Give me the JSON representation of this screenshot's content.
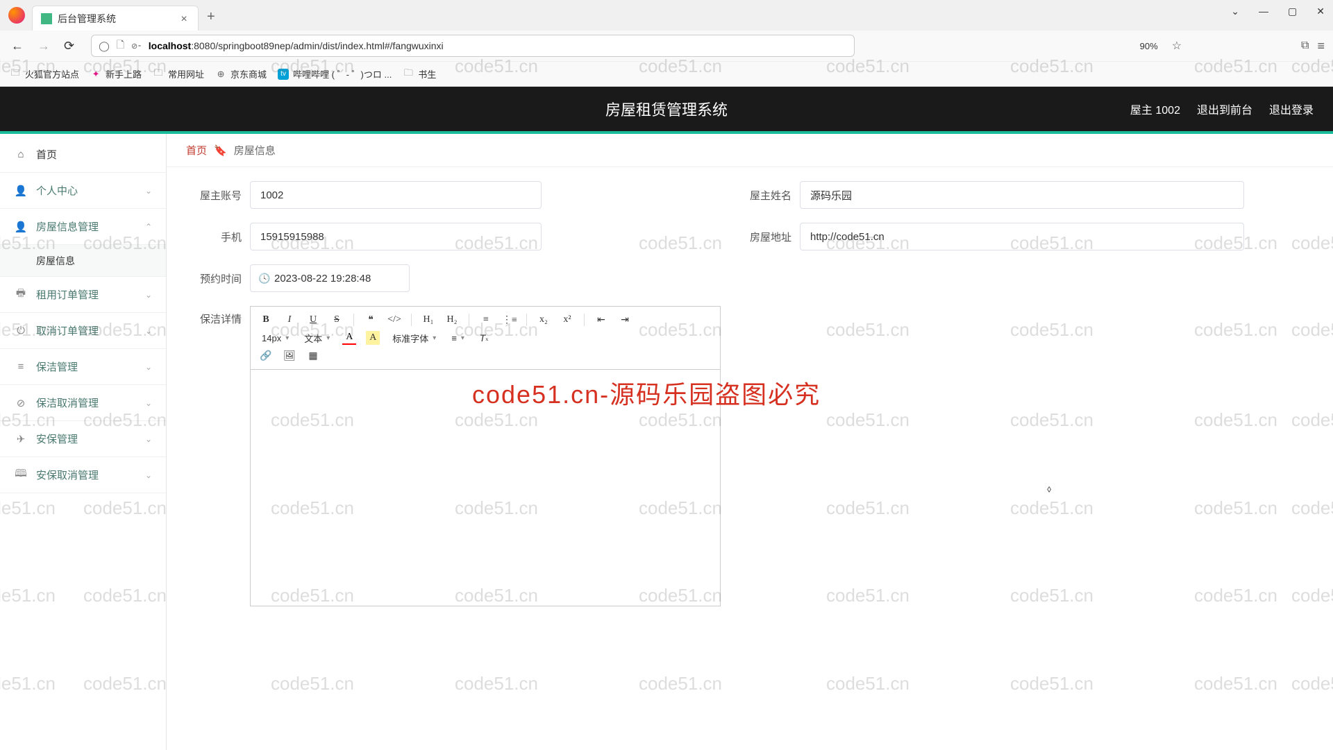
{
  "browser": {
    "tab_title": "后台管理系统",
    "url_host": "localhost",
    "url_path": ":8080/springboot89nep/admin/dist/index.html#/fangwuxinxi",
    "zoom": "90%",
    "bookmarks": [
      "火狐官方站点",
      "新手上路",
      "常用网址",
      "京东商城",
      "哔哩哔哩 ( ゜- ゜)つロ ...",
      "书生"
    ]
  },
  "header": {
    "title": "房屋租赁管理系统",
    "user": "屋主 1002",
    "to_front": "退出到前台",
    "logout": "退出登录"
  },
  "sidebar": {
    "home": "首页",
    "items": [
      "个人中心",
      "房屋信息管理",
      "租用订单管理",
      "取消订单管理",
      "保洁管理",
      "保洁取消管理",
      "安保管理",
      "安保取消管理"
    ],
    "sub_item": "房屋信息"
  },
  "breadcrumb": {
    "home": "首页",
    "current": "房屋信息"
  },
  "form": {
    "account_label": "屋主账号",
    "account_value": "1002",
    "name_label": "屋主姓名",
    "name_value": "源码乐园",
    "phone_label": "手机",
    "phone_value": "15915915988",
    "address_label": "房屋地址",
    "address_value": "http://code51.cn",
    "appt_label": "预约时间",
    "appt_value": "2023-08-22 19:28:48",
    "detail_label": "保洁详情"
  },
  "editor": {
    "font_size": "14px",
    "text_type": "文本",
    "font_family": "标准字体"
  },
  "watermark": {
    "repeat": "code51.cn",
    "banner": "code51.cn-源码乐园盗图必究"
  }
}
